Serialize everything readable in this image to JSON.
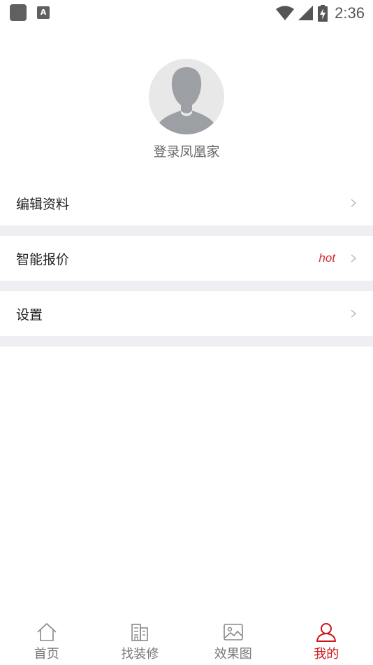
{
  "status_bar": {
    "time": "2:36",
    "notification_icon": "A"
  },
  "profile": {
    "login_text": "登录凤凰家"
  },
  "menu": [
    {
      "label": "编辑资料",
      "badge": ""
    },
    {
      "label": "智能报价",
      "badge": "hot"
    },
    {
      "label": "设置",
      "badge": ""
    }
  ],
  "bottom_nav": [
    {
      "label": "首页",
      "icon": "home-icon",
      "active": false
    },
    {
      "label": "找装修",
      "icon": "building-icon",
      "active": false
    },
    {
      "label": "效果图",
      "icon": "image-icon",
      "active": false
    },
    {
      "label": "我的",
      "icon": "user-icon",
      "active": true
    }
  ],
  "colors": {
    "accent": "#d0121b",
    "separator": "#efeef3",
    "hot": "#d32f2f"
  }
}
